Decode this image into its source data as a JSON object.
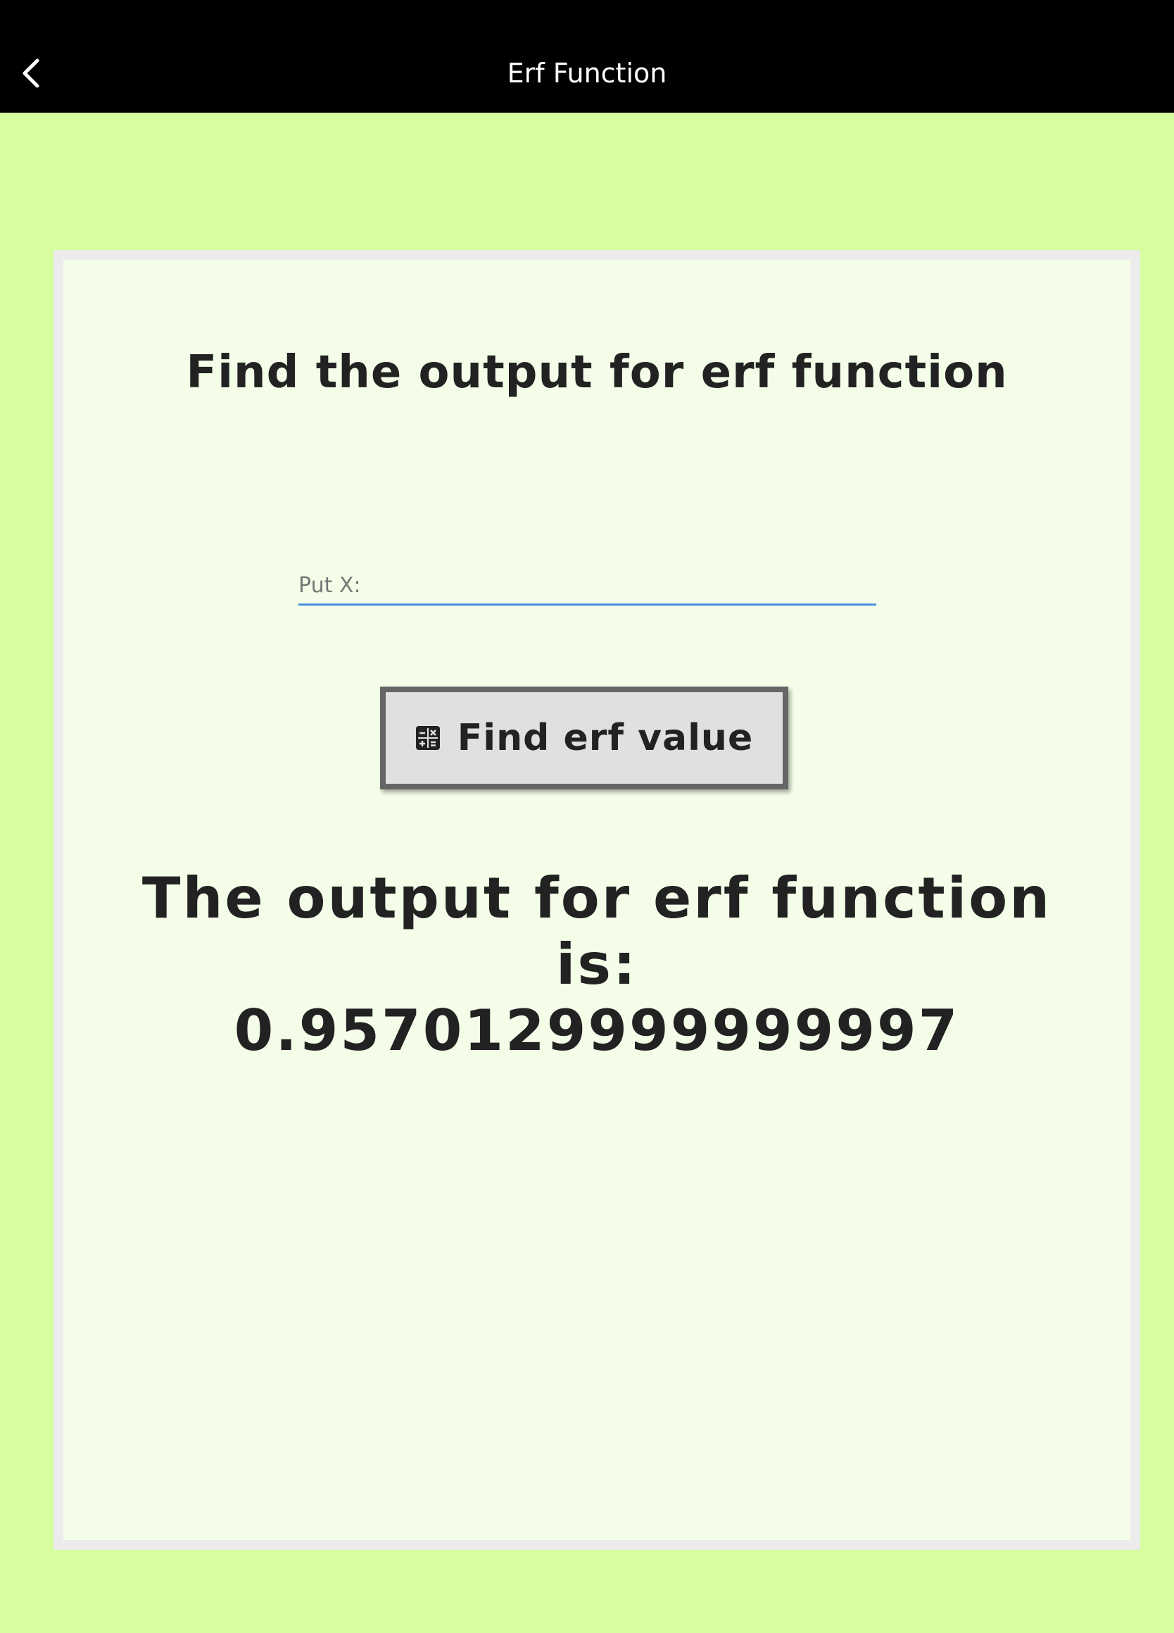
{
  "app_bar": {
    "title": "Erf Function",
    "back_icon": "chevron-left-icon"
  },
  "card": {
    "heading": "Find the output for erf function",
    "input": {
      "placeholder": "Put X:",
      "value": ""
    },
    "button": {
      "icon": "calculator-icon",
      "label": "Find erf value"
    },
    "result": {
      "prefix_line1": "The output for erf function",
      "prefix_line2": "is:",
      "value": "0.9570129999999997"
    }
  },
  "colors": {
    "background": "#d7fd9e",
    "app_bar": "#000000",
    "card": "#f3fde8",
    "input_underline": "#4a8fe0",
    "button_fill": "#e0e0e0",
    "button_border": "#666666"
  }
}
